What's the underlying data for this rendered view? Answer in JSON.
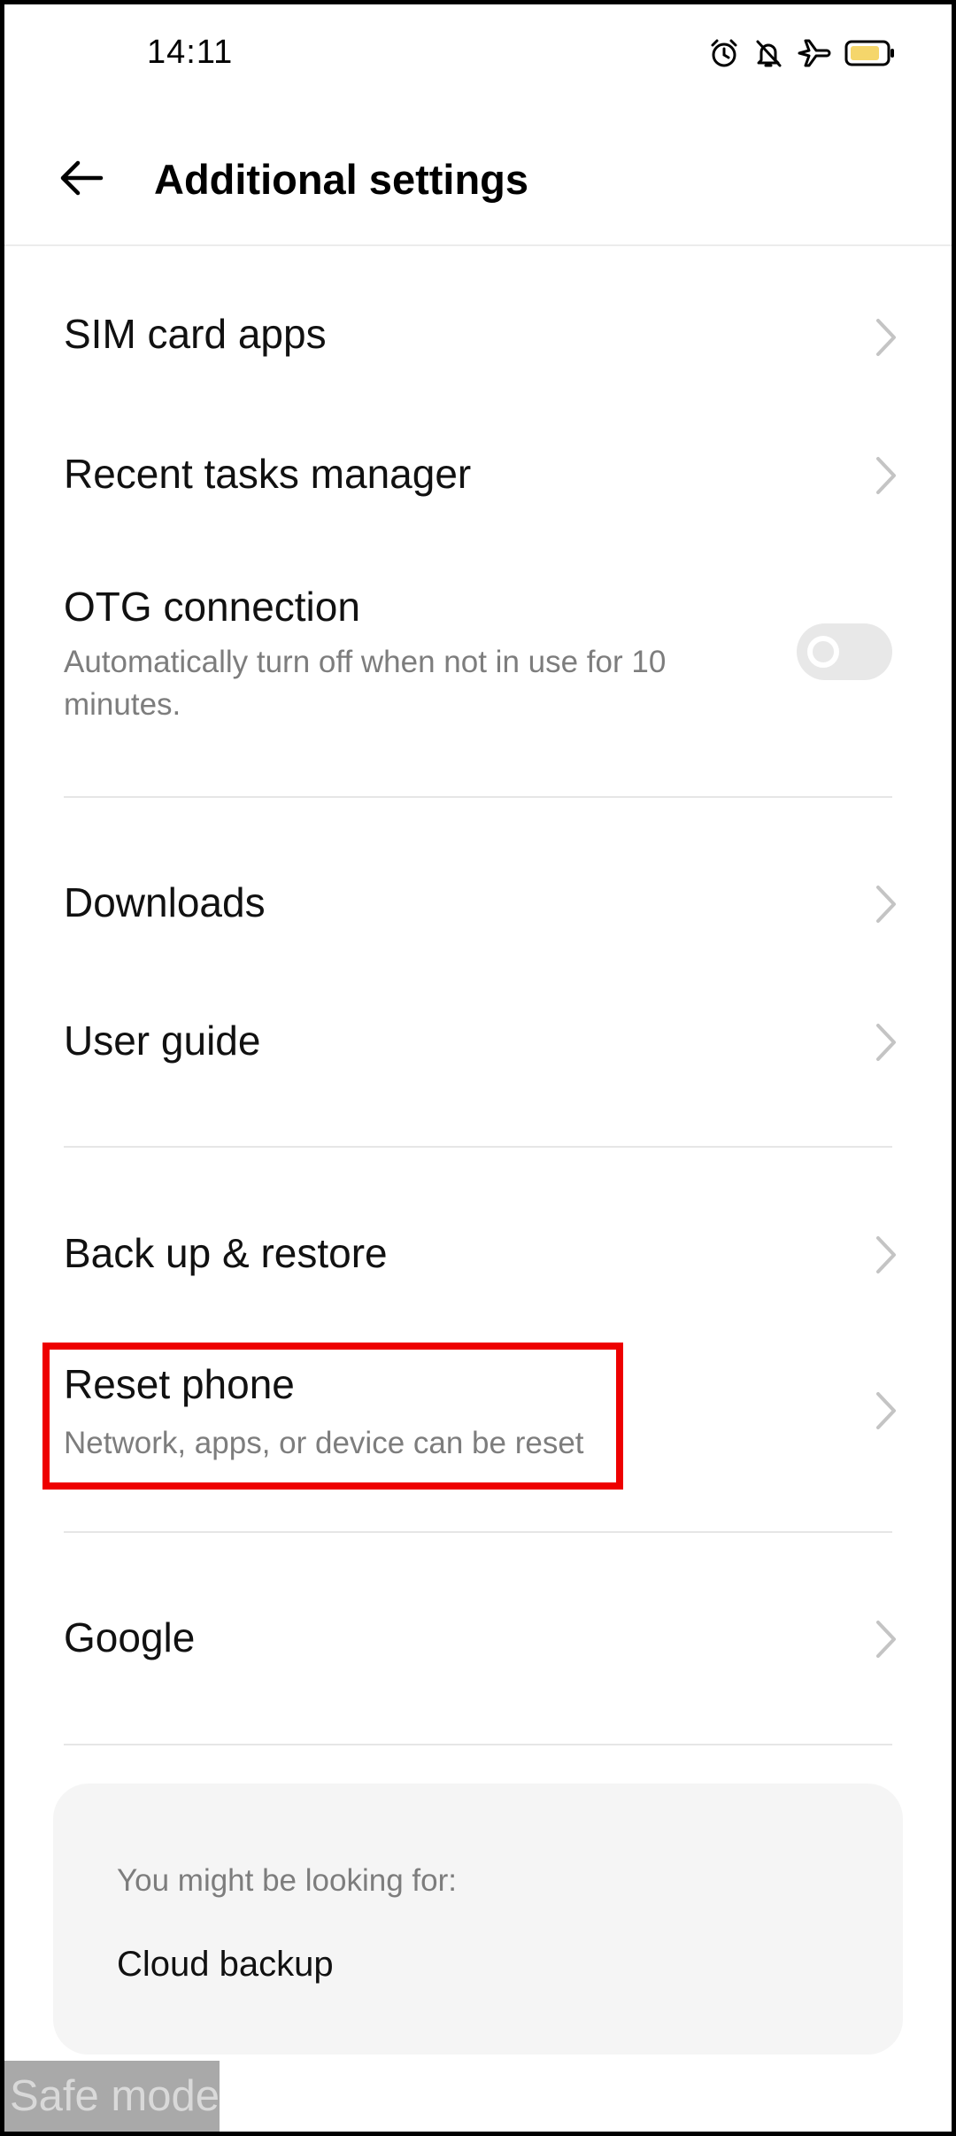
{
  "status_bar": {
    "time": "14:11",
    "icons": [
      "alarm-icon",
      "bell-muted-icon",
      "airplane-mode-icon",
      "battery-icon"
    ],
    "battery_color": "#f5d66b"
  },
  "header": {
    "back_icon": "arrow-left-icon",
    "title": "Additional settings"
  },
  "items": {
    "sim_card_apps": {
      "label": "SIM card apps"
    },
    "recent_tasks": {
      "label": "Recent tasks manager"
    },
    "otg": {
      "label": "OTG connection",
      "description_line1": "Automatically turn off when not in use for 10",
      "description_line2": "minutes.",
      "toggle_on": false
    },
    "downloads": {
      "label": "Downloads"
    },
    "user_guide": {
      "label": "User guide"
    },
    "backup_restore": {
      "label": "Back up & restore"
    },
    "reset_phone": {
      "label": "Reset phone",
      "description": "Network, apps, or device can be reset"
    },
    "google": {
      "label": "Google"
    }
  },
  "suggestions": {
    "heading": "You might be looking for:",
    "items": [
      "Cloud backup"
    ]
  },
  "safe_mode": {
    "label": "Safe mode"
  },
  "colors": {
    "highlight": "#ee0000",
    "secondary_text": "#7d7d7d",
    "card_background": "#f5f5f5"
  }
}
